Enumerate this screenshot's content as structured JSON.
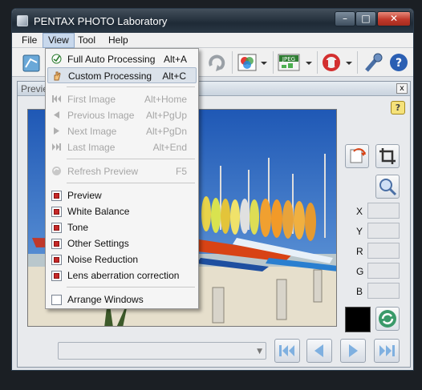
{
  "window": {
    "title": "PENTAX PHOTO Laboratory"
  },
  "menubar": {
    "file": "File",
    "view": "View",
    "tool": "Tool",
    "help": "Help"
  },
  "preview": {
    "title": "Previe",
    "close": "x",
    "help_glyph": "?"
  },
  "coords": {
    "x": "X",
    "y": "Y",
    "r": "R",
    "g": "G",
    "b": "B"
  },
  "view_menu": {
    "items": [
      {
        "label": "Full Auto Processing",
        "shortcut": "Alt+A",
        "enabled": true
      },
      {
        "label": "Custom Processing",
        "shortcut": "Alt+C",
        "enabled": true,
        "highlighted": true
      },
      {
        "label": "First Image",
        "shortcut": "Alt+Home",
        "enabled": false
      },
      {
        "label": "Previous Image",
        "shortcut": "Alt+PgUp",
        "enabled": false
      },
      {
        "label": "Next Image",
        "shortcut": "Alt+PgDn",
        "enabled": false
      },
      {
        "label": "Last Image",
        "shortcut": "Alt+End",
        "enabled": false
      },
      {
        "label": "Refresh Preview",
        "shortcut": "F5",
        "enabled": false
      },
      {
        "label": "Preview",
        "checked": true
      },
      {
        "label": "White Balance",
        "checked": true
      },
      {
        "label": "Tone",
        "checked": true
      },
      {
        "label": "Other Settings",
        "checked": true
      },
      {
        "label": "Noise Reduction",
        "checked": true
      },
      {
        "label": "Lens aberration correction",
        "checked": true
      },
      {
        "label": "Arrange Windows",
        "checked": false
      }
    ]
  },
  "toolbar": {
    "jpeg_label": "JPEG"
  },
  "colors": {
    "accent": "#c62828",
    "titlebar": "#1e2a36"
  }
}
